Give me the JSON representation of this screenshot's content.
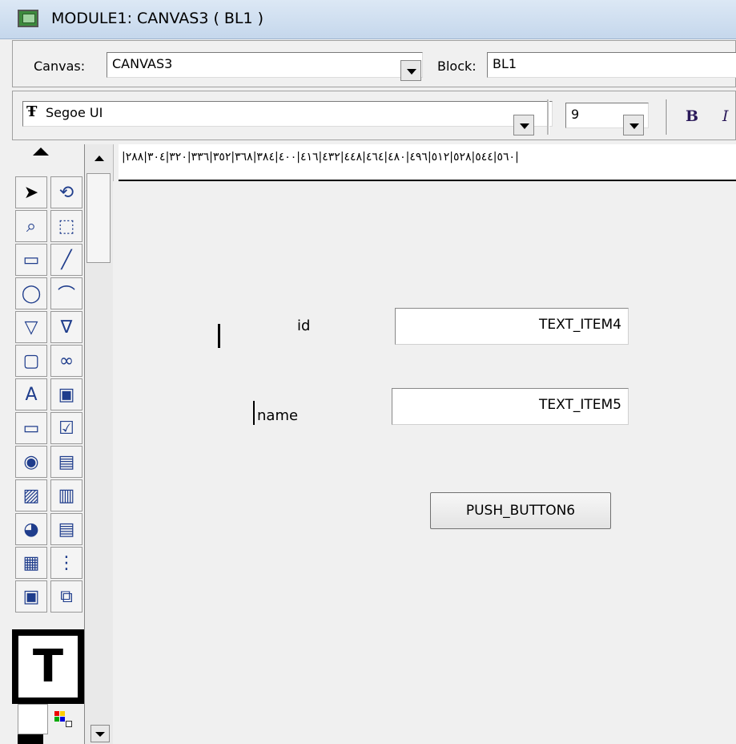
{
  "window": {
    "title": "MODULE1: CANVAS3 ( BL1 )"
  },
  "toolbar": {
    "canvas_label": "Canvas:",
    "canvas_value": "CANVAS3",
    "block_label": "Block:",
    "block_value": "BL1",
    "font_value": "Segoe UI",
    "size_value": "9",
    "bold_label": "B",
    "italic_label": "I"
  },
  "ruler": {
    "ticks": "|٥٦٠|٥٤٤|٥٢٨|٥١٢|٤٩٦|٤٨٠|٤٦٤|٤٤٨|٤٣٢|٤١٦|٤٠٠|٣٨٤|٣٦٨|٣٥٢|٣٣٦|٣٢٠|٣٠٤|٢٨٨|"
  },
  "canvas": {
    "id_label": "id",
    "name_label": "name",
    "text_item4": "TEXT_ITEM4",
    "text_item5": "TEXT_ITEM5",
    "push_button": "PUSH_BUTTON6"
  },
  "palette": {
    "tools": [
      "select-pointer",
      "rotate",
      "magnify",
      "reshape",
      "rectangle",
      "line",
      "ellipse",
      "arc",
      "polygon",
      "polyline",
      "rounded-rectangle",
      "freehand",
      "text",
      "frame",
      "text-item",
      "check-box",
      "radio-button",
      "list-item",
      "image",
      "chart",
      "sound",
      "display-item",
      "tab-canvas",
      "hierarchical-tree",
      "stacked-canvas",
      "toolbar-canvas"
    ],
    "big_tool_label": "T"
  }
}
